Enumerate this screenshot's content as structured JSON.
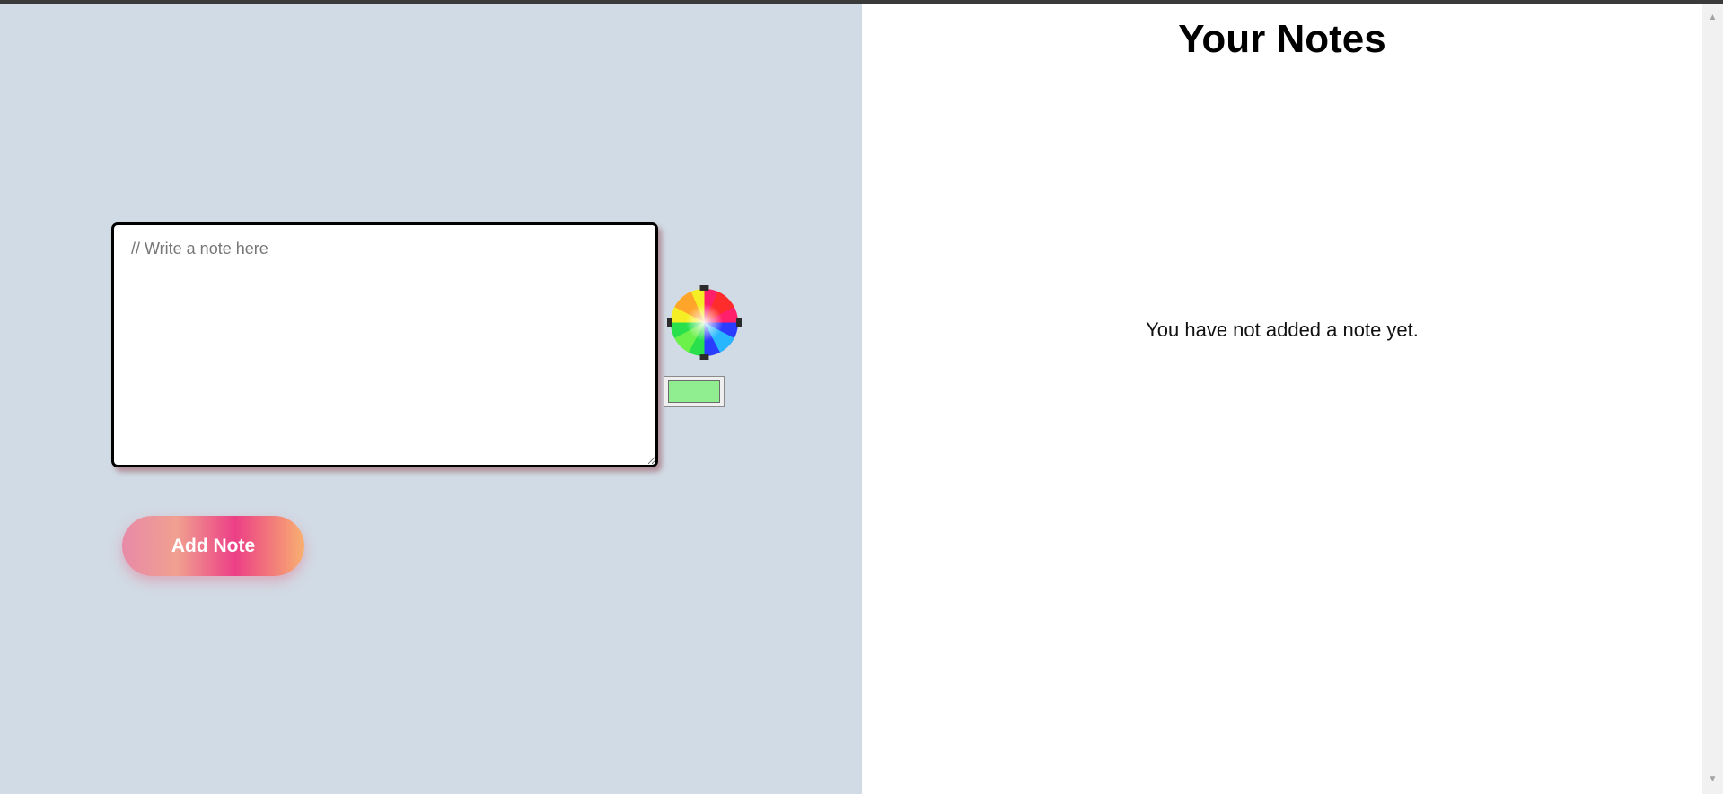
{
  "composer": {
    "placeholder": "// Write a note here",
    "value": "",
    "selected_color": "#90ee90",
    "color_picker_icon": "color-wheel-icon",
    "add_button_label": "Add Note"
  },
  "notes_panel": {
    "title": "Your Notes",
    "empty_message": "You have not added a note yet."
  },
  "scrollbar": {
    "up_icon": "arrow-up-icon",
    "down_icon": "arrow-down-icon",
    "up_glyph": "▲",
    "down_glyph": "▼"
  },
  "colors": {
    "left_background": "#d1dbe5",
    "right_background": "#ffffff",
    "top_bar": "#3a3a3a"
  }
}
